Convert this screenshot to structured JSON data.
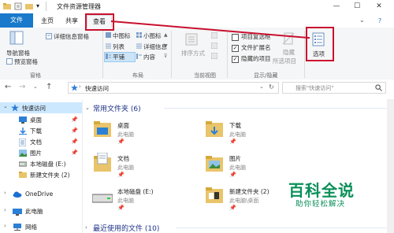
{
  "window": {
    "title": "文件资源管理器",
    "controls": {
      "minimize": "—",
      "maximize": "☐",
      "close": "✕"
    }
  },
  "tabs": {
    "file": "文件",
    "home": "主页",
    "share": "共享",
    "view": "查看",
    "help": "?"
  },
  "ribbon": {
    "panes": {
      "nav_pane": "导航窗格",
      "preview_pane": "预览窗格",
      "details_pane": "详细信息窗格",
      "group": "窗格"
    },
    "layout": {
      "items": [
        "中图标",
        "小图标",
        "列表",
        "详细信息",
        "平铺",
        "内容"
      ],
      "group": "布局"
    },
    "current_view": {
      "sort": "排序方式",
      "group": "当前视图"
    },
    "show_hide": {
      "checkboxes": "项目复选框",
      "extensions": "文件扩展名",
      "hidden_items": "隐藏的项目",
      "hide_selected": "隐藏",
      "hide_selected_2": "所选项目",
      "group": "显示/隐藏"
    },
    "options": {
      "label": "选项"
    }
  },
  "address": {
    "back": "←",
    "forward": "→",
    "up": "↑",
    "path": "快速访问",
    "search_placeholder": "搜索\"快速访问\""
  },
  "nav": {
    "quick_access": "快速访问",
    "items": [
      "桌面",
      "下载",
      "文档",
      "图片",
      "本地磁盘 (E:)",
      "新建文件夹 (2)"
    ],
    "onedrive": "OneDrive",
    "this_pc": "此电脑",
    "network": "网络"
  },
  "content": {
    "frequent_header": "常用文件夹 (6)",
    "folders": [
      {
        "name": "桌面",
        "sub": "此电脑"
      },
      {
        "name": "下载",
        "sub": "此电脑"
      },
      {
        "name": "文档",
        "sub": "此电脑"
      },
      {
        "name": "图片",
        "sub": "此电脑"
      },
      {
        "name": "本地磁盘 (E:)",
        "sub": "此电脑"
      },
      {
        "name": "新建文件夹 (2)",
        "sub": "此电脑\\桌面"
      }
    ],
    "recent_header": "最近使用的文件 (10)"
  },
  "watermark": {
    "title": "百科全说",
    "subtitle": "助你轻松解决"
  },
  "colors": {
    "accent": "#1979ca",
    "annotation": "#c8102e",
    "watermark": "#0a8f58",
    "folder": "#e9c46a"
  }
}
